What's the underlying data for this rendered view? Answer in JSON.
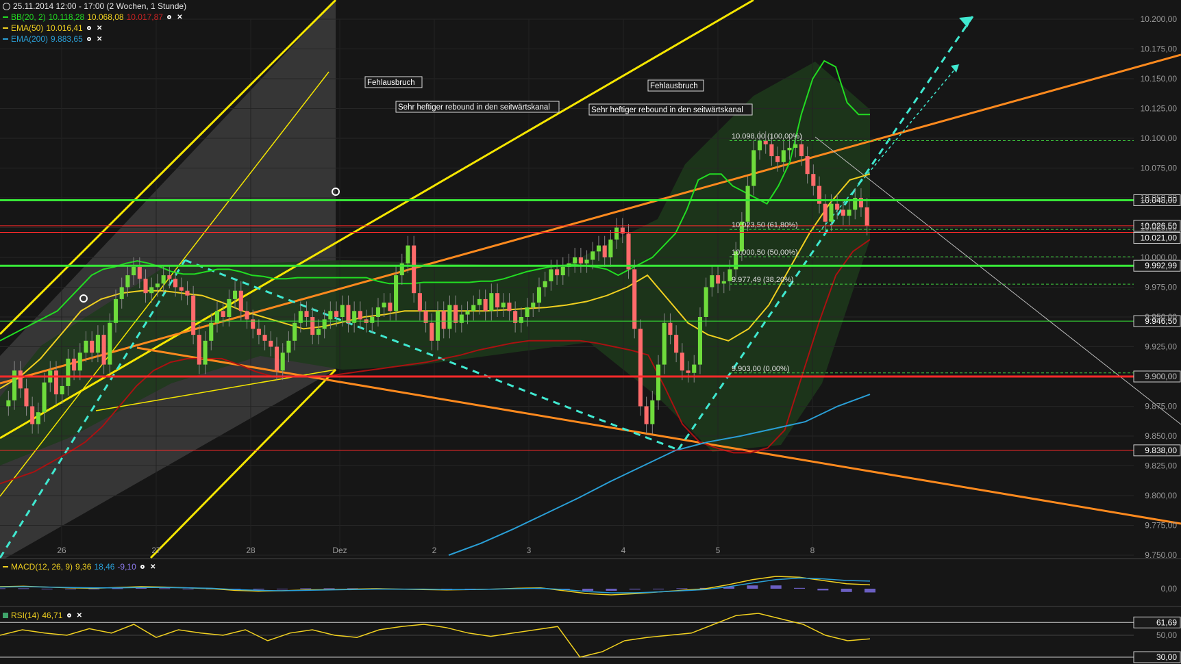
{
  "header": {
    "title": "25.11.2014 12:00 - 17:00 (2 Wochen, 1 Stunde)",
    "bb_label": "BB(20, 2)",
    "bb_upper": "10.118,28",
    "bb_mid": "10.068,08",
    "bb_lower": "10.017,87",
    "ema50_label": "EMA(50)",
    "ema50_value": "10.016,41",
    "ema200_label": "EMA(200)",
    "ema200_value": "9.883,65"
  },
  "annotations": [
    {
      "text": "Fehlausbruch"
    },
    {
      "text": "Sehr heftiger rebound in den seitwärtskanal"
    },
    {
      "text": "Fehlausbruch"
    },
    {
      "text": "Sehr heftiger rebound in den seitwärtskanal"
    }
  ],
  "fib_labels": [
    "10.098,00 (100,00%)",
    "10.023,50 (61,80%)",
    "10.000,50 (50,00%)",
    "9.977,49 (38,20%)",
    "9.903,00 (0,00%)"
  ],
  "price_tags": [
    "10.048,00",
    "10.026,50",
    "10.021,00",
    "9.992,99",
    "9.946,50",
    "9.900,00",
    "9.838,00"
  ],
  "macd": {
    "label": "MACD(12, 26, 9)",
    "v1": "9,36",
    "v2": "18,46",
    "v3": "-9,10",
    "axis_tick": "0,00"
  },
  "rsi": {
    "label": "RSI(14)",
    "value": "46,71",
    "ticks": [
      "61,69",
      "50,00",
      "30,00"
    ]
  },
  "colors": {
    "background": "#161616",
    "bull": "#6fdc3c",
    "bear": "#ff6b6b",
    "bb_upper": "#22dd22",
    "bb_lower": "#aa1111",
    "ema50": "#f0d020",
    "ema200": "#2a9fd6",
    "trend_orange": "#ff8a1e",
    "channel_yellow": "#f5e600",
    "arrow_cyan": "#40e8d0",
    "hline_green": "#38e838",
    "hline_red": "#ff2a2a"
  },
  "chart_data": {
    "type": "candlestick",
    "instrument_period": "2 Wochen, 1 Stunde",
    "x_ticks": [
      "26",
      "27",
      "28",
      "Dez",
      "2",
      "3",
      "4",
      "5",
      "8"
    ],
    "y_ticks": [
      "10.200,00",
      "10.175,00",
      "10.150,00",
      "10.125,00",
      "10.100,00",
      "10.075,00",
      "10.050,00",
      "10.025,00",
      "10.000,00",
      "9.975,00",
      "9.950,00",
      "9.925,00",
      "9.900,00",
      "9.875,00",
      "9.850,00",
      "9.825,00",
      "9.800,00",
      "9.775,00",
      "9.750,00"
    ],
    "ylim": [
      9750,
      10200
    ],
    "close": [
      9880,
      9905,
      9890,
      9875,
      9860,
      9870,
      9895,
      9905,
      9885,
      9892,
      9915,
      9905,
      9920,
      9930,
      9920,
      9935,
      9910,
      9945,
      9965,
      9975,
      9985,
      9992,
      9982,
      9970,
      9975,
      9978,
      9985,
      9982,
      9975,
      9972,
      9968,
      9935,
      9910,
      9930,
      9945,
      9955,
      9950,
      9965,
      9972,
      9955,
      9948,
      9940,
      9935,
      9930,
      9925,
      9905,
      9920,
      9930,
      9945,
      9955,
      9950,
      9935,
      9940,
      9948,
      9955,
      9950,
      9960,
      9945,
      9955,
      9948,
      9945,
      9950,
      9958,
      9962,
      9955,
      9985,
      9995,
      10010,
      9970,
      9955,
      9945,
      9930,
      9955,
      9940,
      9960,
      9945,
      9952,
      9955,
      9960,
      9965,
      9955,
      9970,
      9958,
      9962,
      9955,
      9945,
      9950,
      9958,
      9962,
      9975,
      9980,
      9990,
      9985,
      9992,
      9995,
      10000,
      9995,
      9998,
      10005,
      10010,
      10000,
      10015,
      10025,
      10020,
      9990,
      9940,
      9875,
      9860,
      9880,
      9910,
      9945,
      9935,
      9920,
      9905,
      9903,
      9910,
      9950,
      9975,
      9985,
      9978,
      9980,
      9990,
      10005,
      10030,
      10060,
      10090,
      10098,
      10095,
      10085,
      10080,
      10090,
      10092,
      10095,
      10085,
      10070,
      10060,
      10045,
      10030,
      10045,
      10040,
      10035,
      10040,
      10050,
      10042,
      10026.5
    ],
    "bb_upper": [
      9930,
      9935,
      9940,
      9945,
      9950,
      9955,
      9965,
      9975,
      9985,
      9990,
      9992,
      9995,
      9997,
      9995,
      9992,
      9988,
      9986,
      9986,
      9988,
      9990,
      9990,
      9988,
      9985,
      9984,
      9982,
      9982,
      9983,
      9983,
      9983,
      9983,
      9983,
      9983,
      9983,
      9980,
      9978,
      9978,
      9978,
      9979,
      9979,
      9979,
      9979,
      9979,
      9980,
      9980,
      9982,
      9985,
      9988,
      9990,
      9992,
      9993,
      9994,
      9993,
      9992,
      9990,
      9985,
      9990,
      9995,
      10000,
      10010,
      10020,
      10040,
      10065,
      10070,
      10070,
      10060,
      10055,
      10050,
      10045,
      10060,
      10080,
      10120,
      10150,
      10165,
      10160,
      10130,
      10120,
      10120
    ],
    "bb_lower": [
      9810,
      9815,
      9820,
      9828,
      9836,
      9845,
      9858,
      9875,
      9892,
      9905,
      9912,
      9915,
      9915,
      9915,
      9910,
      9904,
      9900,
      9900,
      9900,
      9900,
      9902,
      9904,
      9906,
      9908,
      9910,
      9912,
      9915,
      9918,
      9922,
      9925,
      9928,
      9930,
      9930,
      9930,
      9930,
      9928,
      9925,
      9922,
      9918,
      9890,
      9860,
      9845,
      9840,
      9836,
      9836,
      9840,
      9855,
      9900,
      9945,
      9985,
      10005,
      10015
    ],
    "ema50": [
      9890,
      9900,
      9915,
      9935,
      9955,
      9965,
      9970,
      9972,
      9972,
      9970,
      9968,
      9962,
      9955,
      9950,
      9945,
      9940,
      9942,
      9946,
      9950,
      9952,
      9955,
      9955,
      9955,
      9955,
      9955,
      9956,
      9957,
      9958,
      9960,
      9963,
      9968,
      9975,
      9985,
      9965,
      9945,
      9935,
      9930,
      9940,
      9960,
      9990,
      10020,
      10045,
      10065,
      10070
    ],
    "ema200": [
      9750,
      9760,
      9772,
      9785,
      9798,
      9812,
      9825,
      9838,
      9845,
      9850,
      9856,
      9862,
      9875,
      9885
    ],
    "horizontal_levels": [
      10048,
      10026.5,
      10021,
      9992.99,
      9946.5,
      9900,
      9838
    ],
    "fibonacci": {
      "high": 10098,
      "low": 9903,
      "levels": [
        {
          "pct": "100,00%",
          "value": 10098
        },
        {
          "pct": "61,80%",
          "value": 10023.5
        },
        {
          "pct": "50,00%",
          "value": 10000.5
        },
        {
          "pct": "38,20%",
          "value": 9977.49
        },
        {
          "pct": "0,00%",
          "value": 9903
        }
      ]
    },
    "macd_series": {
      "macd": [
        5,
        6,
        4,
        2,
        1,
        3,
        5,
        4,
        2,
        0,
        -4,
        -6,
        -5,
        -3,
        -2,
        -1,
        0,
        -1,
        -2,
        -3,
        -2,
        -1,
        1,
        2,
        -5,
        -12,
        -15,
        -12,
        -8,
        -4,
        0,
        10,
        22,
        30,
        28,
        20,
        12,
        9.36
      ],
      "signal": [
        4,
        5,
        4,
        3,
        2,
        2,
        3,
        3,
        2,
        1,
        -2,
        -4,
        -5,
        -4,
        -3,
        -2,
        -1,
        -1,
        -1,
        -2,
        -2,
        -1,
        0,
        1,
        -2,
        -7,
        -10,
        -10,
        -8,
        -5,
        -2,
        5,
        14,
        22,
        26,
        24,
        20,
        18.46
      ]
    },
    "rsi_series": [
      50,
      55,
      52,
      50,
      56,
      52,
      60,
      48,
      55,
      52,
      50,
      55,
      45,
      52,
      55,
      50,
      48,
      55,
      58,
      60,
      57,
      52,
      49,
      52,
      55,
      58,
      30,
      35,
      45,
      48,
      50,
      52,
      60,
      68,
      70,
      65,
      60,
      50,
      45,
      46.71
    ]
  }
}
